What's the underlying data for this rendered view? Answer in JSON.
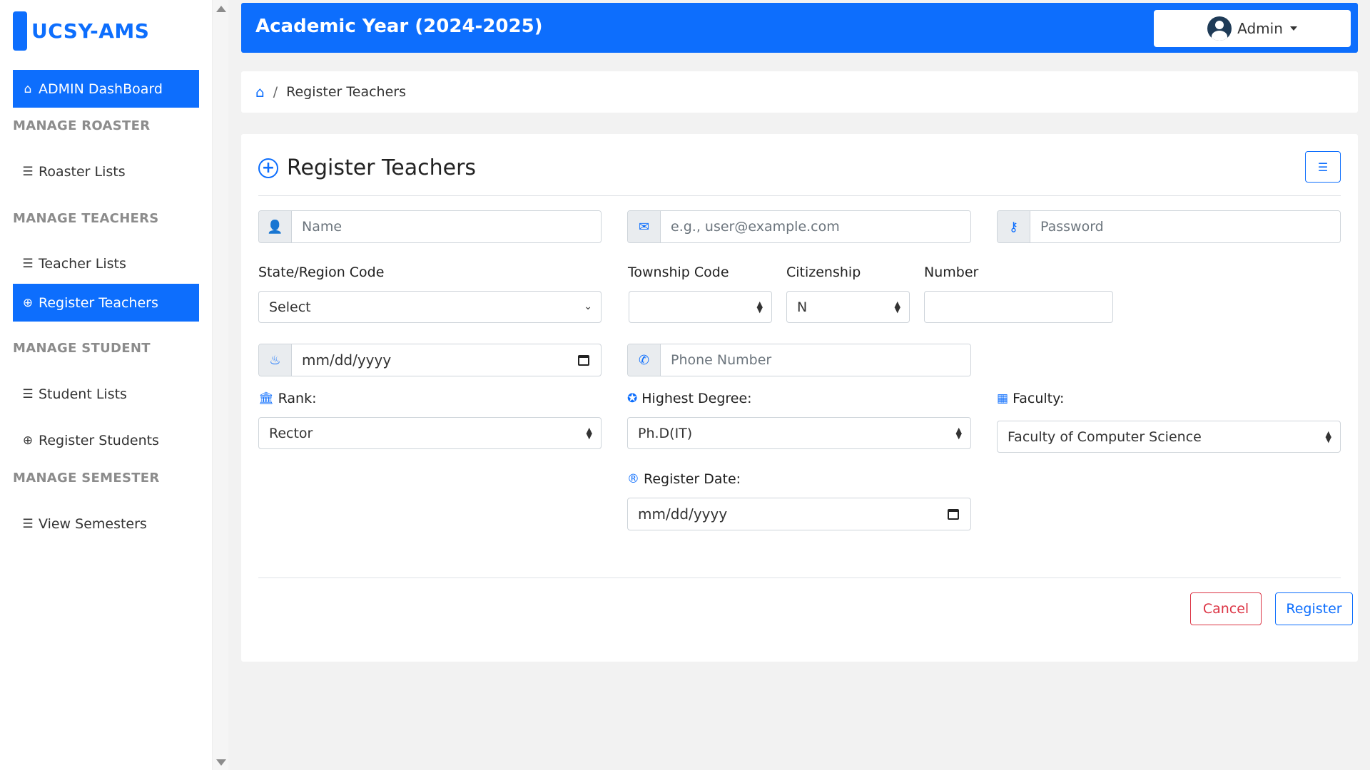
{
  "app": {
    "brand": "UCSY-AMS"
  },
  "sidebar": {
    "dashboard": "ADMIN DashBoard",
    "sections": {
      "roaster": "MANAGE ROASTER",
      "teachers": "MANAGE TEACHERS",
      "student": "MANAGE STUDENT",
      "semester": "MANAGE SEMESTER"
    },
    "items": {
      "roaster_lists": "Roaster Lists",
      "teacher_lists": "Teacher Lists",
      "register_teachers": "Register Teachers",
      "student_lists": "Student Lists",
      "register_students": "Register Students",
      "view_semesters": "View Semesters"
    }
  },
  "header": {
    "title": "Academic Year (2024-2025)",
    "user": "Admin"
  },
  "breadcrumb": {
    "current": "Register Teachers"
  },
  "form": {
    "title": "Register Teachers",
    "name_placeholder": "Name",
    "email_placeholder": "e.g., user@example.com",
    "password_placeholder": "Password",
    "state_label": "State/Region Code",
    "state_value": "Select",
    "township_label": "Township Code",
    "township_value": "",
    "citizenship_label": "Citizenship",
    "citizenship_value": "N",
    "number_label": "Number",
    "dob_value": "mm/dd/yyyy",
    "phone_placeholder": "Phone Number",
    "rank_label": "Rank:",
    "rank_value": "Rector",
    "degree_label": "Highest Degree:",
    "degree_value": "Ph.D(IT)",
    "faculty_label": "Faculty:",
    "faculty_value": "Faculty of Computer Science",
    "register_date_label": "Register Date:",
    "register_date_value": "mm/dd/yyyy",
    "cancel": "Cancel",
    "register": "Register"
  },
  "icons": {
    "home": "home-icon",
    "list": "list-icon",
    "plus_circle": "plus-circle-icon",
    "user": "user-icon",
    "envelope": "envelope-icon",
    "key": "key-icon",
    "cake": "birthday-cake-icon",
    "phone": "phone-icon",
    "bank": "bank-icon",
    "award": "award-icon",
    "building": "building-icon",
    "registered": "registered-icon",
    "calendar": "calendar-icon"
  },
  "colors": {
    "primary": "#0d6efd",
    "danger": "#dc3545",
    "muted": "#8c8c8c"
  }
}
